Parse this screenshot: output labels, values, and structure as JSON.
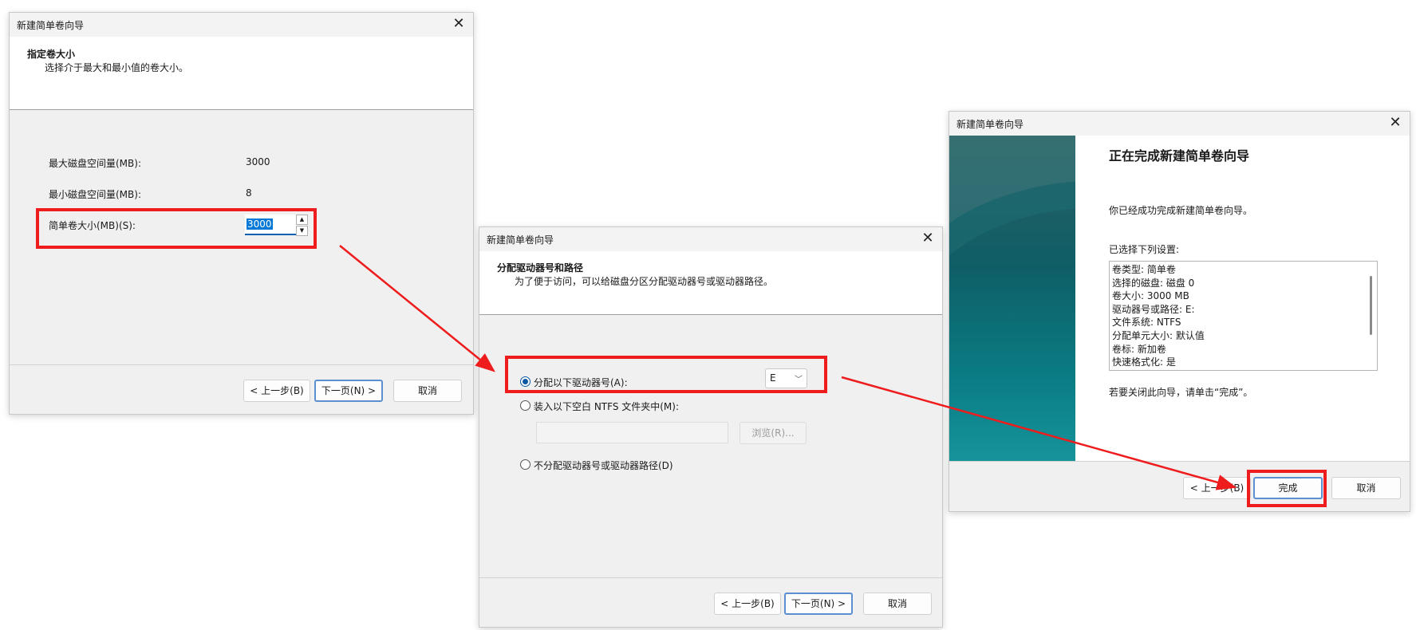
{
  "dialog1": {
    "title": "新建简单卷向导",
    "header_title": "指定卷大小",
    "header_subtitle": "选择介于最大和最小值的卷大小。",
    "max_label": "最大磁盘空间量(MB):",
    "max_value": "3000",
    "min_label": "最小磁盘空间量(MB):",
    "min_value": "8",
    "size_label": "简单卷大小(MB)(S):",
    "size_value": "3000",
    "back_label": "< 上一步(B)",
    "next_label": "下一页(N) >",
    "cancel_label": "取消"
  },
  "dialog2": {
    "title": "新建简单卷向导",
    "header_title": "分配驱动器号和路径",
    "header_subtitle": "为了便于访问，可以给磁盘分区分配驱动器号或驱动器路径。",
    "option_assign_label": "分配以下驱动器号(A):",
    "drive_letter": "E",
    "option_mount_label": "装入以下空白 NTFS 文件夹中(M):",
    "browse_label": "浏览(R)...",
    "option_none_label": "不分配驱动器号或驱动器路径(D)",
    "back_label": "< 上一步(B)",
    "next_label": "下一页(N) >",
    "cancel_label": "取消"
  },
  "dialog3": {
    "title": "新建简单卷向导",
    "heading": "正在完成新建简单卷向导",
    "intro": "你已经成功完成新建简单卷向导。",
    "settings_label": "已选择下列设置:",
    "settings": [
      "卷类型: 简单卷",
      "选择的磁盘: 磁盘 0",
      "卷大小: 3000 MB",
      "驱动器号或路径: E:",
      "文件系统: NTFS",
      "分配单元大小: 默认值",
      "卷标: 新加卷",
      "快速格式化: 是"
    ],
    "close_hint": "若要关闭此向导，请单击“完成”。",
    "back_label": "< 上一步(B)",
    "finish_label": "完成",
    "cancel_label": "取消"
  },
  "colors": {
    "annotation_red": "#ee1c1c",
    "selection_blue": "#0078d7",
    "banner_teal": "#0f6f79"
  }
}
